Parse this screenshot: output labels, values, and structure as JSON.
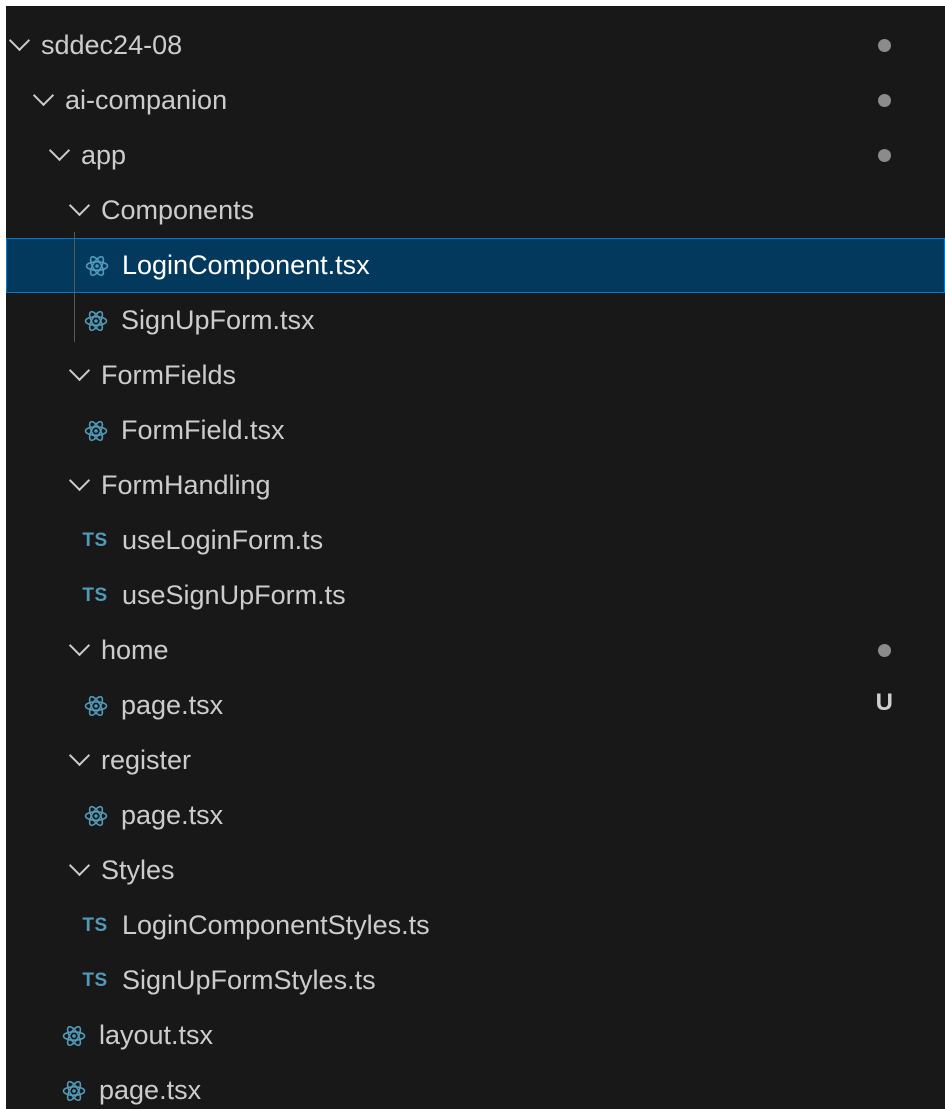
{
  "explorer": {
    "folder_root": {
      "label": "sddec24-08",
      "modified": true
    },
    "folder_ai_companion": {
      "label": "ai-companion",
      "modified": true
    },
    "folder_app": {
      "label": "app",
      "modified": true
    },
    "folder_components": {
      "label": "Components"
    },
    "file_login_component": {
      "label": "LoginComponent.tsx",
      "icon": "react-icon",
      "selected": true
    },
    "file_signup_form": {
      "label": "SignUpForm.tsx",
      "icon": "react-icon"
    },
    "folder_formfields": {
      "label": "FormFields"
    },
    "file_formfield": {
      "label": "FormField.tsx",
      "icon": "react-icon"
    },
    "folder_formhandling": {
      "label": "FormHandling"
    },
    "file_use_login_form": {
      "label": "useLoginForm.ts",
      "icon": "typescript-icon",
      "icon_text": "TS"
    },
    "file_use_signup_form": {
      "label": "useSignUpForm.ts",
      "icon": "typescript-icon",
      "icon_text": "TS"
    },
    "folder_home": {
      "label": "home",
      "modified": true
    },
    "file_home_page": {
      "label": "page.tsx",
      "icon": "react-icon",
      "status": "U"
    },
    "folder_register": {
      "label": "register"
    },
    "file_register_page": {
      "label": "page.tsx",
      "icon": "react-icon"
    },
    "folder_styles": {
      "label": "Styles"
    },
    "file_login_styles": {
      "label": "LoginComponentStyles.ts",
      "icon": "typescript-icon",
      "icon_text": "TS"
    },
    "file_signup_styles": {
      "label": "SignUpFormStyles.ts",
      "icon": "typescript-icon",
      "icon_text": "TS"
    },
    "file_layout": {
      "label": "layout.tsx",
      "icon": "react-icon"
    },
    "file_app_page": {
      "label": "page.tsx",
      "icon": "react-icon"
    }
  },
  "colors": {
    "background": "#181818",
    "text": "#cccccc",
    "selection_bg": "#04395e",
    "selection_border": "#0078d4",
    "react_icon": "#519aba",
    "typescript_icon": "#519aba",
    "modified_dot": "#8b8b8b"
  }
}
